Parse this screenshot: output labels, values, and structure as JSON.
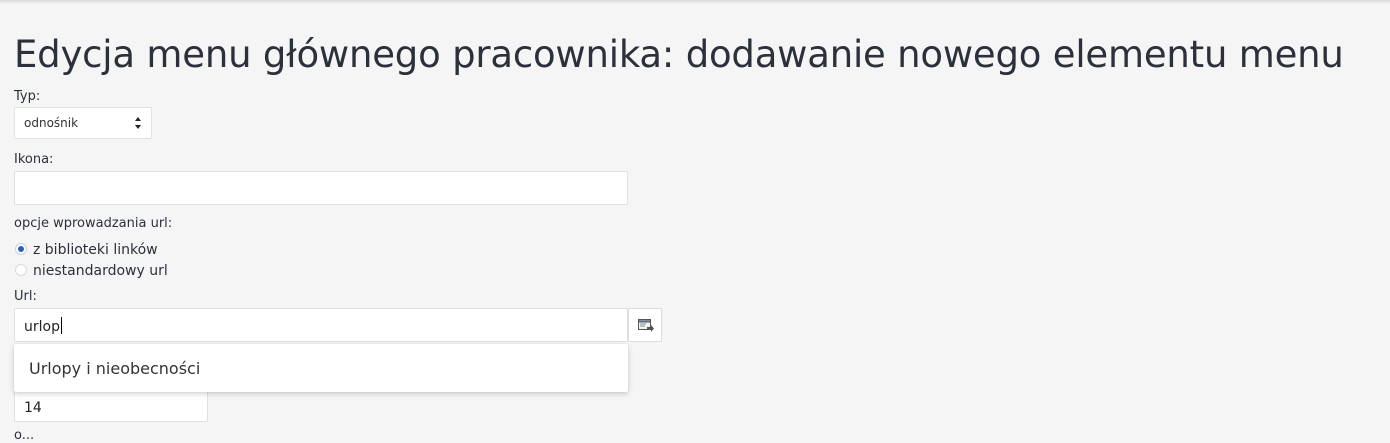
{
  "page": {
    "title": "Edycja menu głównego pracownika: dodawanie nowego elementu menu"
  },
  "form": {
    "type_label": "Typ:",
    "type_value": "odnośnik",
    "icon_label": "Ikona:",
    "icon_value": "",
    "url_options_label": "opcje wprowadzania url:",
    "url_options": [
      {
        "label": "z biblioteki linków",
        "checked": true
      },
      {
        "label": "niestandardowy url",
        "checked": false
      }
    ],
    "url_label": "Url:",
    "url_value": "urlop",
    "url_picker_icon": "link-picker-icon",
    "order_value": "14",
    "partial_label": "o..."
  },
  "autocomplete": {
    "items": [
      "Urlopy i nieobecności"
    ]
  },
  "colors": {
    "background": "#f5f5f5",
    "radio_checked": "#2f5cc4",
    "text": "#2b303b"
  }
}
